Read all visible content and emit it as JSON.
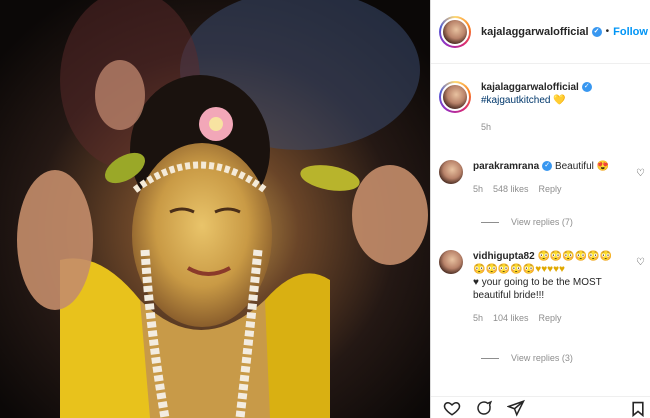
{
  "header": {
    "username": "kajalaggarwalofficial",
    "separator": "•",
    "follow_label": "Follow"
  },
  "caption": {
    "username": "kajalaggarwalofficial",
    "hashtag": "#kajgautkitched",
    "emoji": "💛",
    "time": "5h"
  },
  "comments": [
    {
      "username": "parakramrana",
      "text": "Beautiful 😍",
      "time": "5h",
      "likes": "548 likes",
      "reply": "Reply",
      "view_replies": "View replies (7)"
    },
    {
      "username": "vidhigupta82",
      "emoji_line1": "😳😳😳😳😳😳",
      "emoji_line2": "😳😳😳😳😳♥♥♥♥♥",
      "text": "♥ your going to be the MOST beautiful bride!!!",
      "time": "5h",
      "likes": "104 likes",
      "reply": "Reply",
      "view_replies": "View replies (3)"
    }
  ],
  "icons": {
    "verified": "verified-badge-icon",
    "like": "heart-icon",
    "comment": "comment-icon",
    "share": "share-icon",
    "save": "bookmark-icon"
  },
  "colors": {
    "accent": "#0095f6",
    "verified": "#3897f0",
    "muted": "#8e8e8e"
  }
}
